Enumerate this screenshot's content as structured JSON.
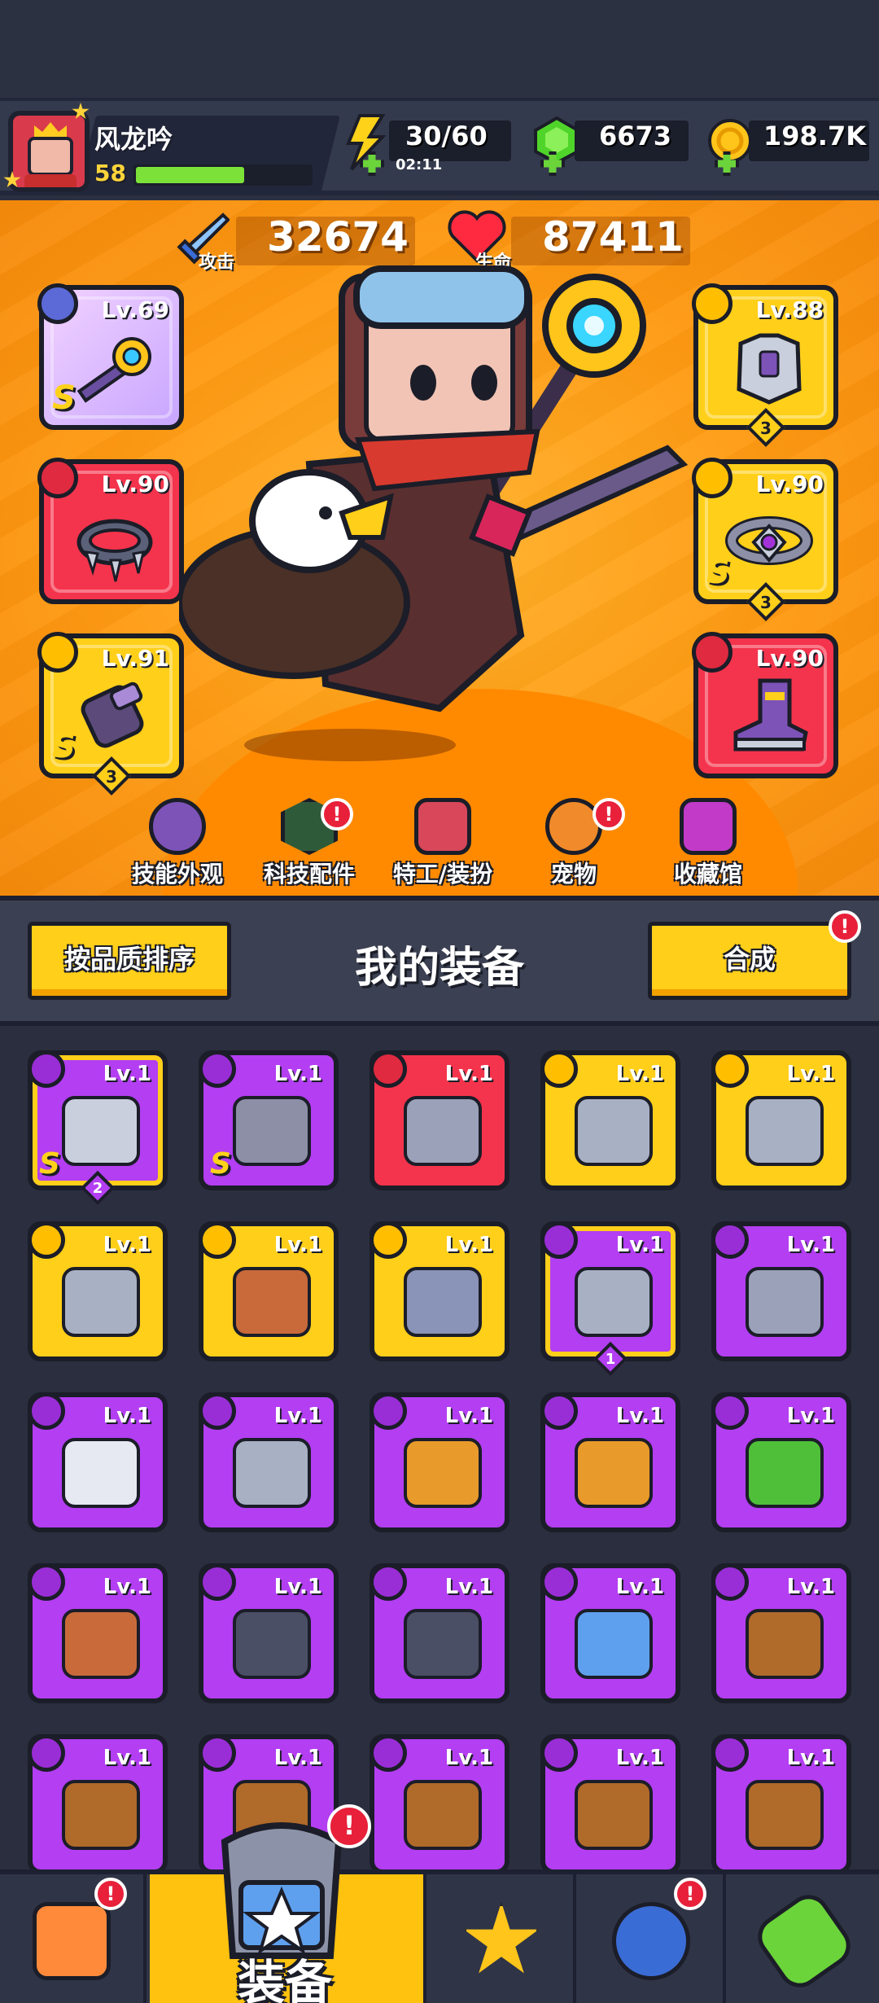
{
  "player": {
    "name": "风龙吟",
    "level": "58",
    "xp_progress": 0.62
  },
  "resources": {
    "energy": "30/60",
    "energy_timer": "02:11",
    "gems": "6673",
    "coins": "198.7K"
  },
  "stats": {
    "attack_label": "攻击",
    "attack_value": "32674",
    "hp_label": "生命",
    "hp_value": "87411"
  },
  "equipped": {
    "weapon": {
      "level": "Lv.69",
      "rarity": "S",
      "icon": "gear-staff-icon"
    },
    "necklace": {
      "level": "Lv.90",
      "icon": "spiked-collar-icon"
    },
    "gloves": {
      "level": "Lv.91",
      "rarity": "S",
      "count": "3",
      "icon": "gauntlet-icon"
    },
    "armor": {
      "level": "Lv.88",
      "count": "3",
      "icon": "chest-armor-icon"
    },
    "belt": {
      "level": "Lv.90",
      "rarity": "S",
      "count": "3",
      "icon": "gem-belt-icon"
    },
    "boots": {
      "level": "Lv.90",
      "icon": "boot-icon"
    }
  },
  "hero_nav": [
    {
      "label": "技能外观",
      "icon": "skill-skin-icon",
      "alert": false
    },
    {
      "label": "科技配件",
      "icon": "tech-part-icon",
      "alert": true
    },
    {
      "label": "特工/装扮",
      "icon": "agent-outfit-icon",
      "alert": false
    },
    {
      "label": "宠物",
      "icon": "pet-icon",
      "alert": true
    },
    {
      "label": "收藏馆",
      "icon": "collection-icon",
      "alert": false
    }
  ],
  "equipment_panel": {
    "sort_label": "按品质排序",
    "title": "我的装备",
    "merge_label": "合成",
    "merge_alert": "!"
  },
  "inventory": [
    {
      "level": "Lv.1",
      "rarity_color": "purple",
      "icon": "chest-armor-icon",
      "slot_type": "armor",
      "s": true,
      "count": "2",
      "framed": true
    },
    {
      "level": "Lv.1",
      "rarity_color": "purple",
      "icon": "gem-belt-icon",
      "slot_type": "belt",
      "s": true
    },
    {
      "level": "Lv.1",
      "rarity_color": "red",
      "icon": "kunai-icon",
      "slot_type": "weapon"
    },
    {
      "level": "Lv.1",
      "rarity_color": "gold",
      "icon": "revolver-icon",
      "slot_type": "weapon"
    },
    {
      "level": "Lv.1",
      "rarity_color": "gold",
      "icon": "revolver-icon",
      "slot_type": "weapon"
    },
    {
      "level": "Lv.1",
      "rarity_color": "gold",
      "icon": "vest-icon",
      "slot_type": "armor"
    },
    {
      "level": "Lv.1",
      "rarity_color": "gold",
      "icon": "fang-necklace-icon",
      "slot_type": "necklace"
    },
    {
      "level": "Lv.1",
      "rarity_color": "gold",
      "icon": "gauntlet-icon",
      "slot_type": "gloves"
    },
    {
      "level": "Lv.1",
      "rarity_color": "purple",
      "icon": "vest-icon",
      "slot_type": "armor",
      "count": "1",
      "framed": true
    },
    {
      "level": "Lv.1",
      "rarity_color": "purple",
      "icon": "kunai-icon",
      "slot_type": "weapon"
    },
    {
      "level": "Lv.1",
      "rarity_color": "purple",
      "icon": "scimitar-icon",
      "slot_type": "weapon"
    },
    {
      "level": "Lv.1",
      "rarity_color": "purple",
      "icon": "revolver-icon",
      "slot_type": "weapon"
    },
    {
      "level": "Lv.1",
      "rarity_color": "purple",
      "icon": "torch-icon",
      "slot_type": "weapon"
    },
    {
      "level": "Lv.1",
      "rarity_color": "purple",
      "icon": "torch-icon",
      "slot_type": "weapon"
    },
    {
      "level": "Lv.1",
      "rarity_color": "purple",
      "icon": "leaf-armor-icon",
      "slot_type": "armor"
    },
    {
      "level": "Lv.1",
      "rarity_color": "purple",
      "icon": "fang-necklace-icon",
      "slot_type": "necklace"
    },
    {
      "level": "Lv.1",
      "rarity_color": "purple",
      "icon": "lantern-necklace-icon",
      "slot_type": "necklace"
    },
    {
      "level": "Lv.1",
      "rarity_color": "purple",
      "icon": "lantern-necklace-icon",
      "slot_type": "necklace"
    },
    {
      "level": "Lv.1",
      "rarity_color": "purple",
      "icon": "shield-necklace-icon",
      "slot_type": "necklace"
    },
    {
      "level": "Lv.1",
      "rarity_color": "purple",
      "icon": "rope-belt-icon",
      "slot_type": "belt"
    },
    {
      "level": "Lv.1",
      "rarity_color": "purple",
      "icon": "rope-belt-icon",
      "slot_type": "belt"
    },
    {
      "level": "Lv.1",
      "rarity_color": "purple",
      "icon": "rope-belt-icon",
      "slot_type": "belt"
    },
    {
      "level": "Lv.1",
      "rarity_color": "purple",
      "icon": "rope-belt-icon",
      "slot_type": "belt"
    },
    {
      "level": "Lv.1",
      "rarity_color": "purple",
      "icon": "rope-belt-icon",
      "slot_type": "belt"
    },
    {
      "level": "Lv.1",
      "rarity_color": "purple",
      "icon": "rope-belt-icon",
      "slot_type": "belt"
    }
  ],
  "bottom_nav": {
    "active_label": "装备",
    "tabs": [
      {
        "icon": "shop-icon",
        "alert": true
      },
      {
        "icon": "equipment-icon",
        "alert": true,
        "active": true
      },
      {
        "icon": "battle-star-icon",
        "alert": false
      },
      {
        "icon": "planet-icon",
        "alert": true
      },
      {
        "icon": "dna-capsule-icon",
        "alert": false
      }
    ]
  },
  "colors": {
    "purple": "#b33ef2",
    "gold": "#ffcf1a",
    "red": "#f4344c",
    "hero_bg": "#ff9a12",
    "panel": "#3b4052"
  }
}
